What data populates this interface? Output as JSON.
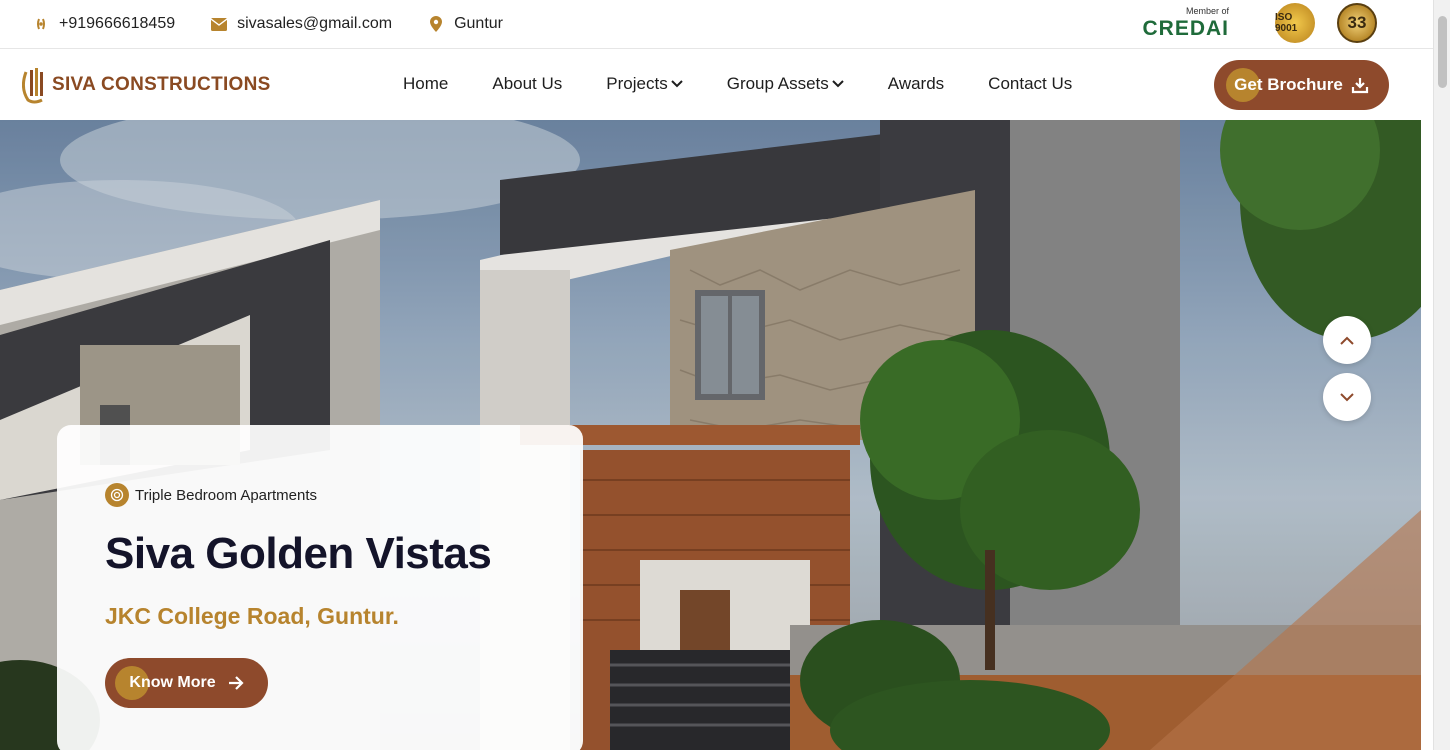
{
  "topbar": {
    "phone": "+919666618459",
    "email": "sivasales@gmail.com",
    "location": "Guntur",
    "credai_small": "Member of",
    "credai_big": "CREDAI",
    "iso_badge": "ISO 9001",
    "years_badge": "33"
  },
  "nav": {
    "logo_text": "SIVA CONSTRUCTIONS",
    "items": [
      {
        "label": "Home"
      },
      {
        "label": "About Us"
      },
      {
        "label": "Projects"
      },
      {
        "label": "Group Assets"
      },
      {
        "label": "Awards"
      },
      {
        "label": "Contact Us"
      }
    ],
    "cta_label": "Get Brochure"
  },
  "hero": {
    "tag": "Triple Bedroom Apartments",
    "title": "Siva Golden Vistas",
    "location": "JKC College Road, Guntur.",
    "button_label": "Know More"
  },
  "colors": {
    "brand_brown": "#8e4a2c",
    "brand_gold": "#b7842e",
    "credai_green": "#1f6b3a"
  },
  "icons": [
    "phone-icon",
    "mail-icon",
    "map-pin-icon",
    "chevron-down-icon",
    "download-icon",
    "chevron-up-icon",
    "arrow-right-icon",
    "target-icon"
  ]
}
